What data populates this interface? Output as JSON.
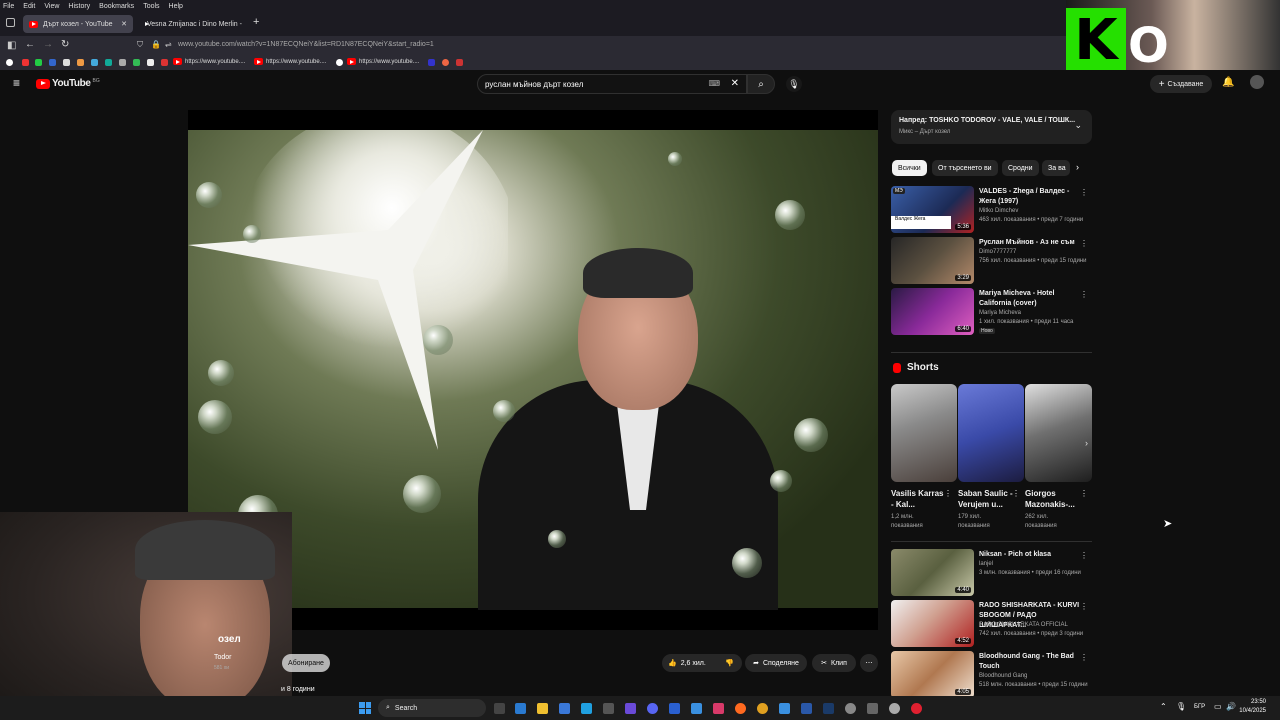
{
  "menubar": [
    "File",
    "Edit",
    "View",
    "History",
    "Bookmarks",
    "Tools",
    "Help"
  ],
  "tabs": [
    {
      "label": "Дърт козел - YouTube",
      "active": true
    },
    {
      "label": "Vesna Zmijanac i Dino Merlin - ",
      "active": false
    }
  ],
  "url": "www.youtube.com/watch?v=1N87ECQNeiY&list=RD1N87ECQNeiY&start_radio=1",
  "bookmarks": [
    "https://www.youtube....",
    "https://www.youtube....",
    "https://www.youtube...."
  ],
  "yt": {
    "logo": "YouTube",
    "country": "BG",
    "search_value": "руслан мъйнов дърт козел",
    "create_label": "Създаване"
  },
  "video": {
    "title_fragment": "озел",
    "channel_fragment": "Todor",
    "subs_fragment": "581 хи",
    "subscribe_label": "Абониране",
    "age_fragment": "и 8 години",
    "likes": "2,6 хил.",
    "share_label": "Споделяне",
    "clip_label": "Клип"
  },
  "upnext": {
    "title": "Напред: TOSHKO TODOROV - VALE, VALE / ТОШК...",
    "subtitle": "Микс – Дърт козел"
  },
  "chips": [
    "Всички",
    "От търсенето ви",
    "Сродни",
    "За ва"
  ],
  "videos": [
    {
      "title": "VALDES - Zhega / Валдес - Жега (1997)",
      "channel": "Mitko Dimchev",
      "meta": "463 хил. показвания • преди 7 години",
      "duration": "5:36",
      "badge": "Валдес Жега"
    },
    {
      "title": "Руслан Мъйнов - Аз не съм",
      "channel": "Dimo7777777",
      "meta": "756 хил. показвания • преди 15 години",
      "duration": "3:29"
    },
    {
      "title": "Mariya Micheva - Hotel California (cover)",
      "channel": "Mariya Micheva",
      "meta": "1 хил. показвания • преди 11 часа",
      "duration": "6:40",
      "new": "Ново"
    }
  ],
  "shorts_title": "Shorts",
  "shorts": [
    {
      "title": "Vasilis Karras - Kal...",
      "views": "1,2 млн.",
      "suffix": "показвания"
    },
    {
      "title": "Saban Saulic - Verujem u...",
      "views": "179 хил.",
      "suffix": "показвания"
    },
    {
      "title": "Giorgos Mazonakis-...",
      "views": "262 хил.",
      "suffix": "показвания"
    }
  ],
  "videos2": [
    {
      "title": "Niksan - Pich ot klasa",
      "channel": "lanjel",
      "meta": "3 млн. показвания • преди 16 години",
      "duration": "4:40"
    },
    {
      "title": "RADO SHISHARKATA - KURVI SBOGOM / РАДО ШИШАРКАТ...",
      "channel": "RADO SHISHARKATA OFFICIAL",
      "meta": "742 хил. показвания • преди 3 години",
      "duration": "4:52"
    },
    {
      "title": "Bloodhound Gang - The Bad Touch",
      "channel": "Bloodhound Gang",
      "meta": "518 млн. показвания • преди 15 години",
      "duration": "4:05"
    }
  ],
  "taskbar": {
    "search": "Search",
    "lang": "БГР",
    "time": "23:50",
    "date": "10/4/2025"
  }
}
